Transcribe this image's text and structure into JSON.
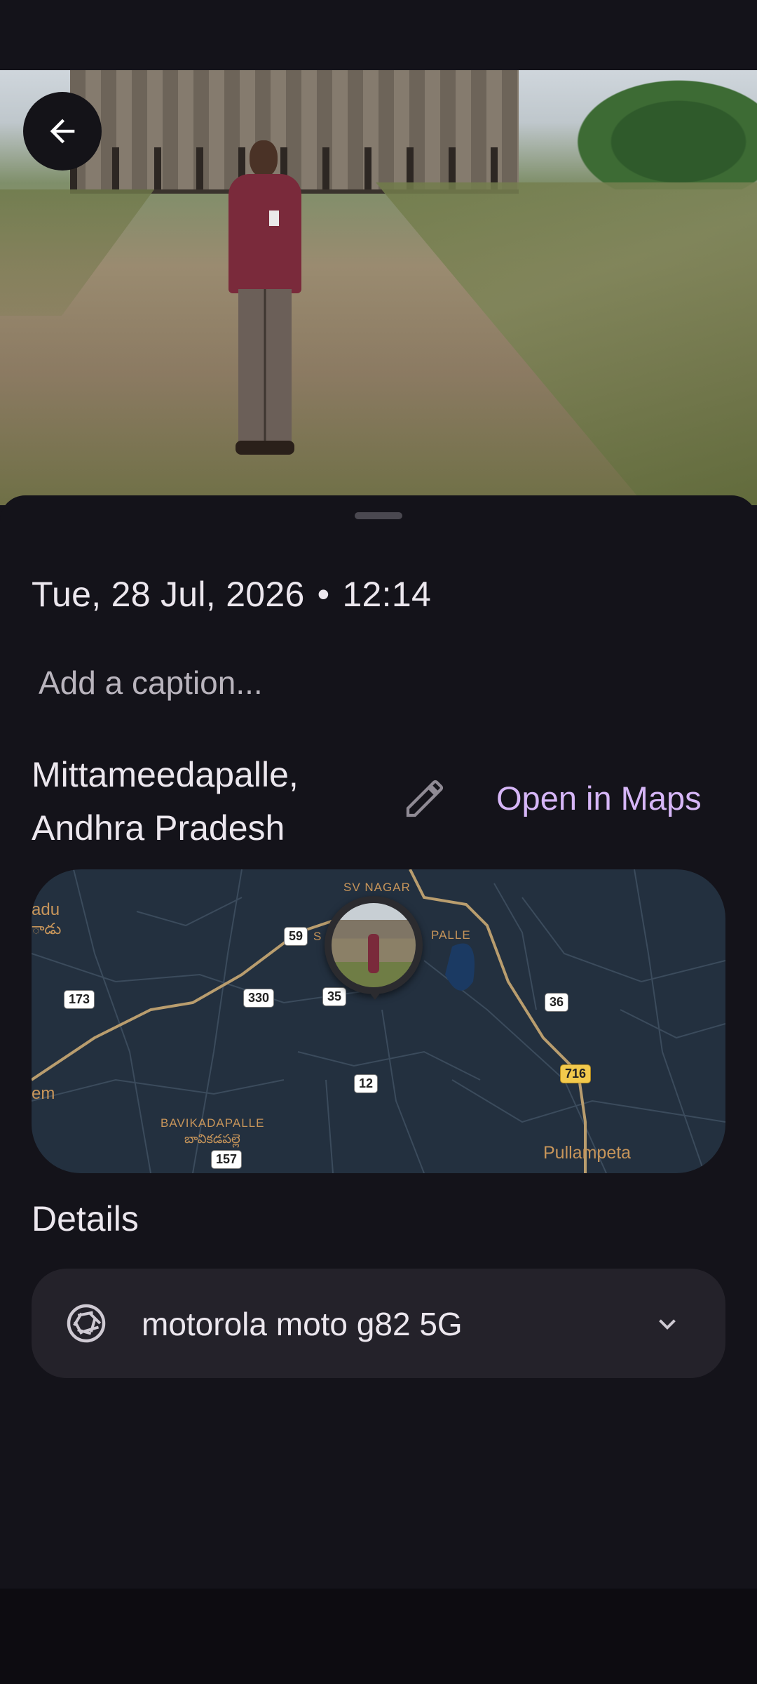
{
  "photo": {
    "alt": ""
  },
  "back_button": {
    "icon": "arrow-left-icon"
  },
  "info": {
    "date": "Tue, 28 Jul, 2026",
    "separator": "•",
    "time": "12:14",
    "caption_placeholder": "Add a caption...",
    "location_line1": "Mittameedapalle,",
    "location_line2": "Andhra Pradesh",
    "open_in_maps": "Open in Maps"
  },
  "map": {
    "labels": {
      "sv_nagar": "SV NAGAR",
      "palle": "PALLE",
      "adu": "adu",
      "adu_te": "ాడు",
      "bavikadapalle": "BAVIKADAPALLE",
      "bavikadapalle_te": "బావికడపల్లె",
      "em": "em",
      "pullampeta": "Pullampeta",
      "s_letter": "S"
    },
    "shields": {
      "r59": "59",
      "r173": "173",
      "r330": "330",
      "r35": "35",
      "r36": "36",
      "r716": "716",
      "r12": "12",
      "r157": "157"
    },
    "colors": {
      "background": "#23303f",
      "road_major": "#b99d6e",
      "road_minor": "#3b4b5c",
      "label": "#c7955a"
    }
  },
  "details": {
    "title": "Details",
    "device": "motorola moto g82 5G",
    "device_icon": "camera-aperture-icon",
    "expand_icon": "chevron-down-icon"
  },
  "colors": {
    "accent": "#d6b6f7",
    "sheet": "#14131a",
    "card": "#24222a"
  }
}
